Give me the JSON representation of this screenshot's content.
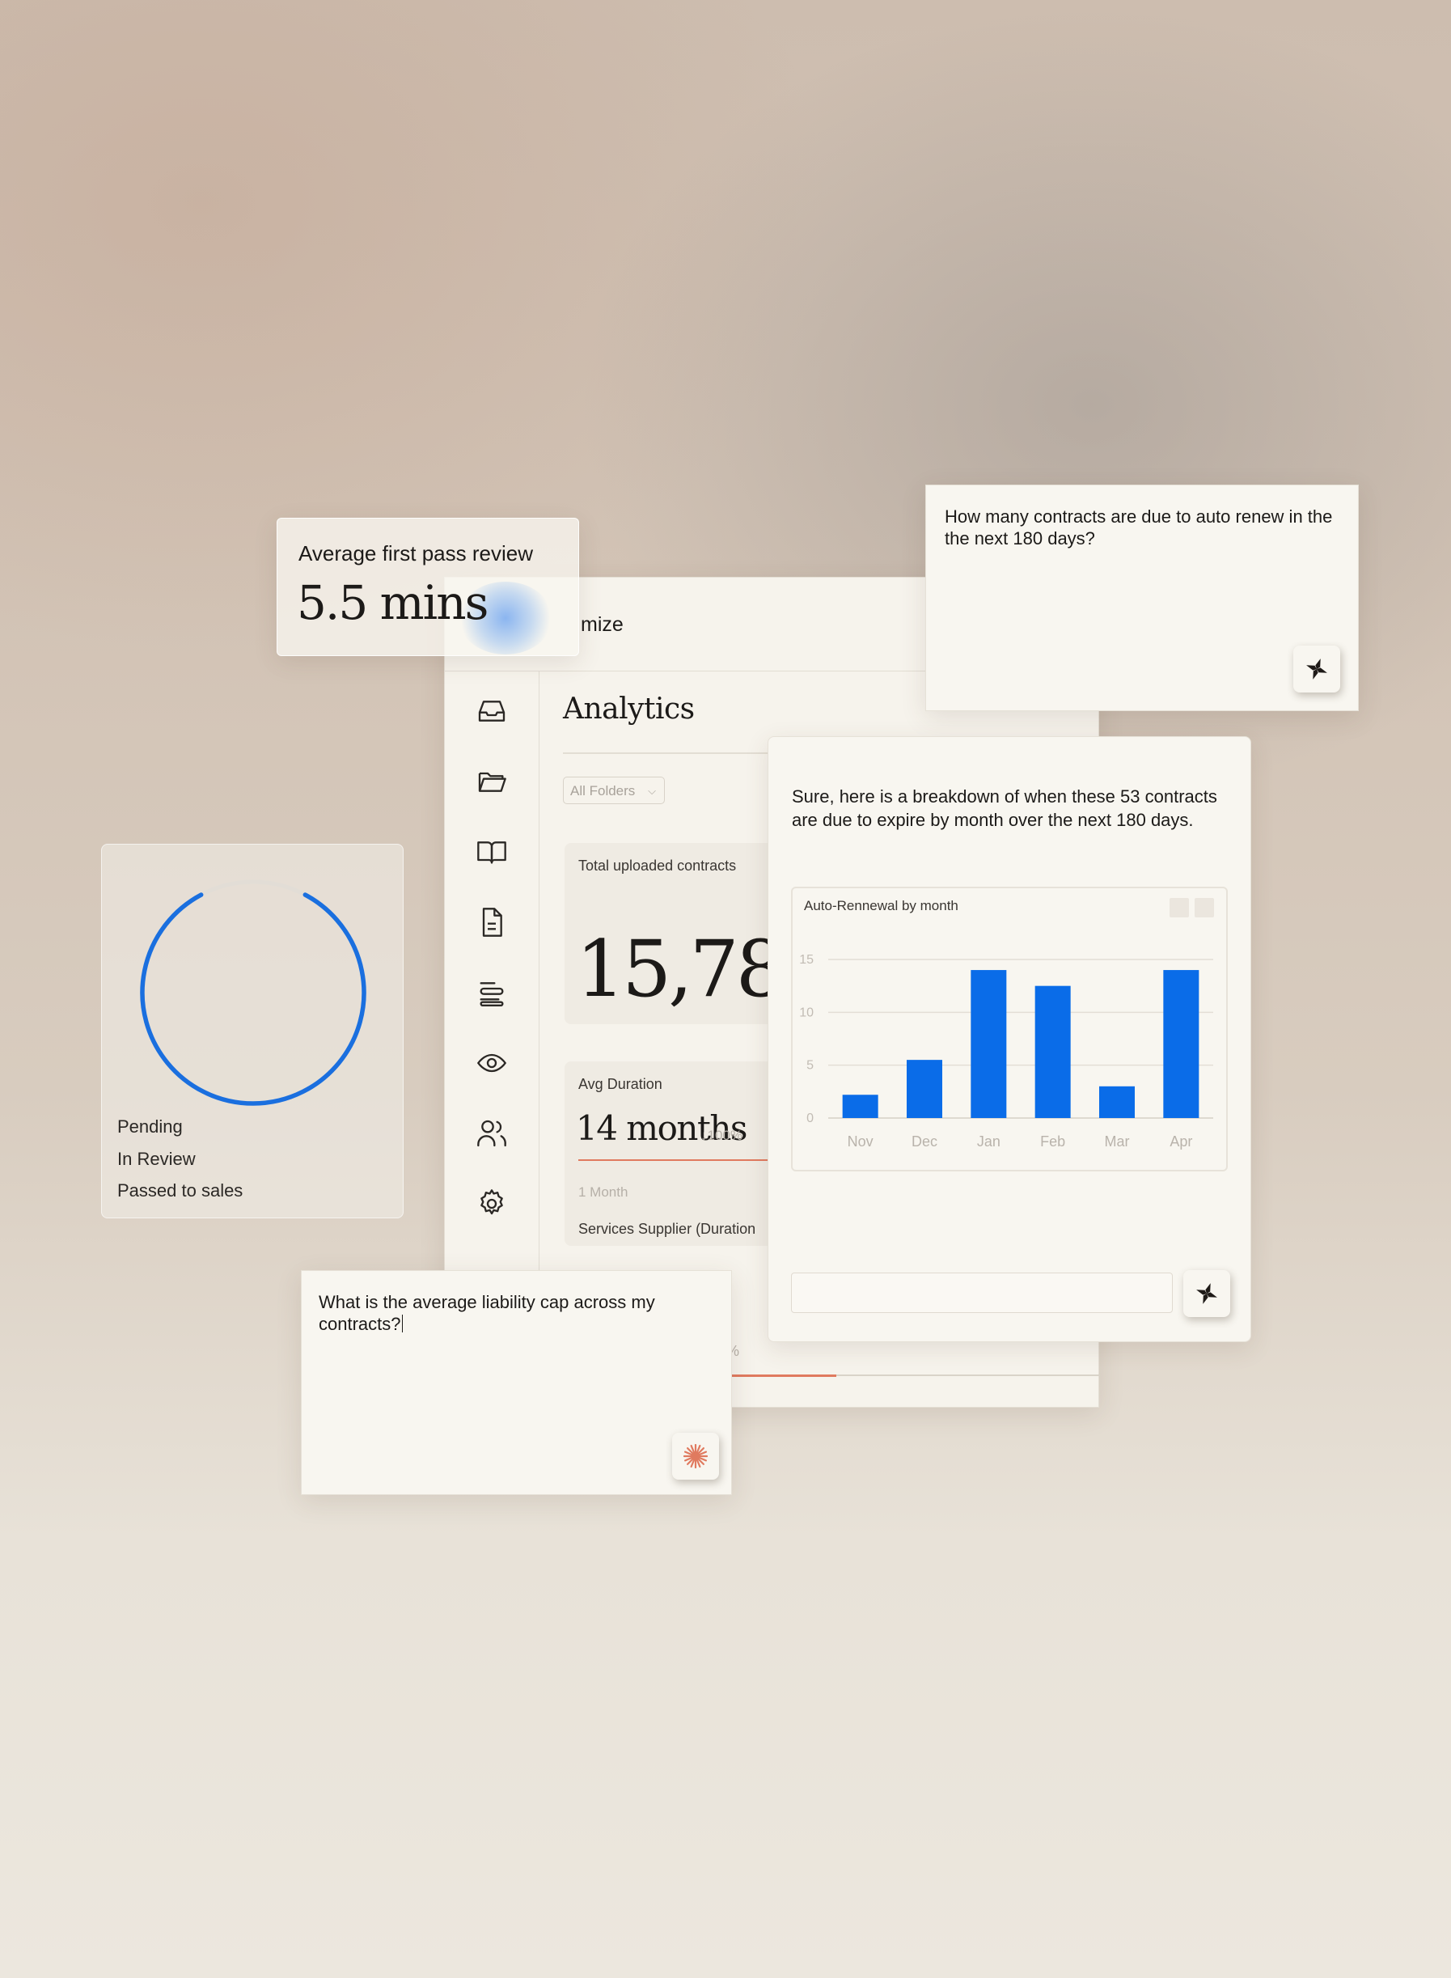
{
  "app": {
    "brand": "mize",
    "title": "Analytics",
    "folder_filter": "All Folders",
    "nav_icons": [
      "inbox-icon",
      "folder-icon",
      "book-icon",
      "document-icon",
      "list-icon",
      "eye-icon",
      "users-icon",
      "gear-icon"
    ],
    "stat_total": {
      "label": "Total uploaded contracts",
      "value": "15,783"
    },
    "stat_duration": {
      "label": "Avg Duration",
      "value": "14 months",
      "delta": "↓100%",
      "sub": "1 Month",
      "name": "Services Supplier (Duration"
    },
    "bottom_pct": "%",
    "accent": "#e07a5f"
  },
  "first_pass": {
    "label": "Average first pass review",
    "value": "5.5 mins"
  },
  "ring_card": {
    "legend": [
      "Pending",
      "In Review",
      "Passed to sales"
    ],
    "ring_color": "#1a6fdf"
  },
  "question_1": {
    "text": "How many contracts are due to auto renew in the the next 180 days?"
  },
  "answer": {
    "text": "Sure, here is a breakdown of when these 53 contracts are due to expire by month over the next 180 days.",
    "chart_title": "Auto-Rennewal by month"
  },
  "question_2": {
    "text": "What is the average liability cap across my contracts?"
  },
  "chart_data": {
    "type": "bar",
    "title": "Auto-Rennewal by month",
    "categories": [
      "Nov",
      "Dec",
      "Jan",
      "Feb",
      "Mar",
      "Apr"
    ],
    "values": [
      2.2,
      5.5,
      14,
      12.5,
      3,
      14
    ],
    "yticks": [
      0,
      5,
      10,
      15
    ],
    "ylim": [
      0,
      15
    ],
    "grid": true,
    "bar_color": "#0a6ce8"
  }
}
